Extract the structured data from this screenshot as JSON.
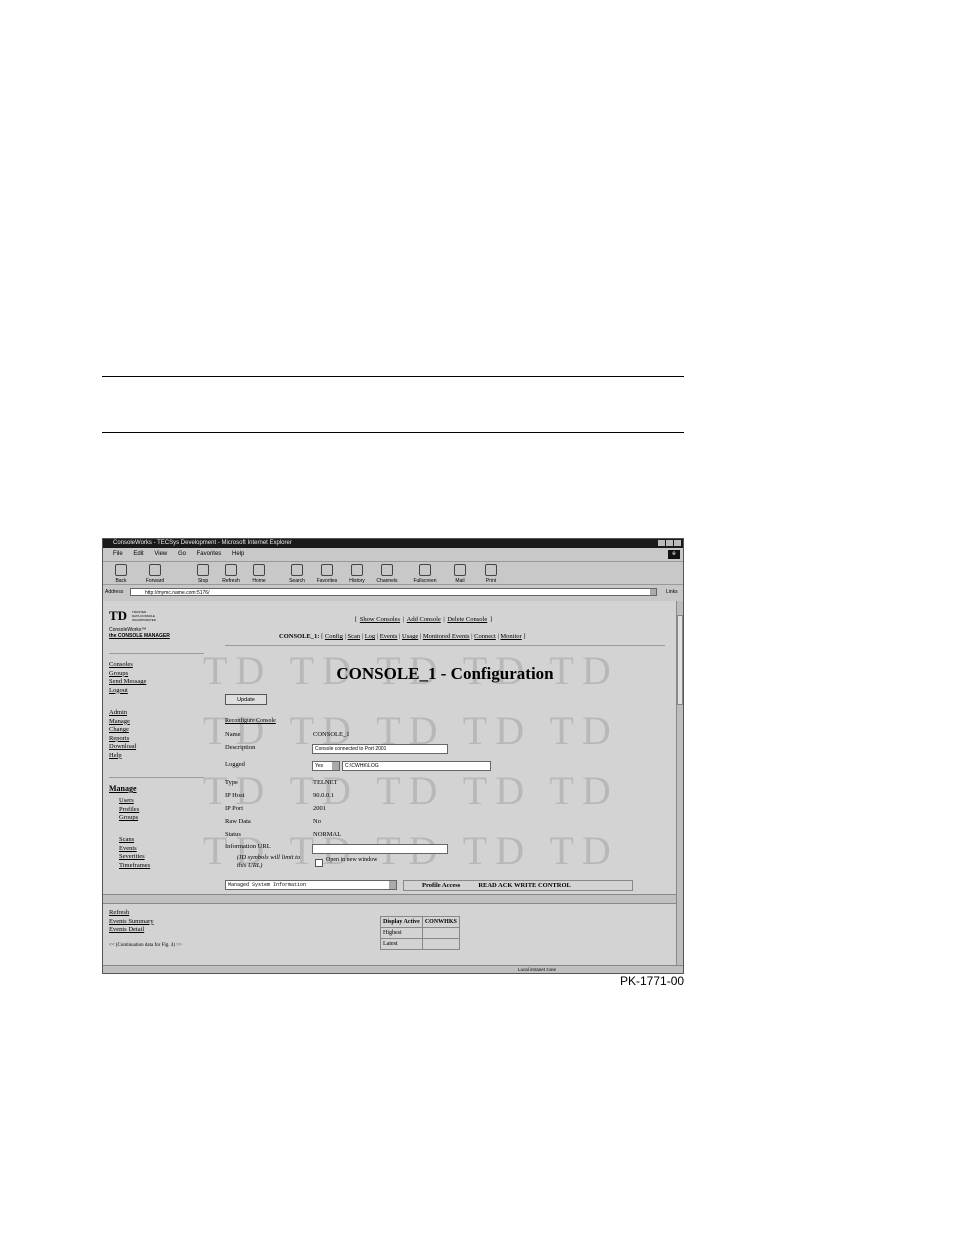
{
  "figure_code": "PK-1771-00",
  "window": {
    "title": "ConsoleWorks - TECSys Development - Microsoft Internet Explorer",
    "menu": [
      "File",
      "Edit",
      "View",
      "Go",
      "Favorites",
      "Help"
    ],
    "toolbar": [
      "Back",
      "Forward",
      "Stop",
      "Refresh",
      "Home",
      "Search",
      "Favorites",
      "History",
      "Channels",
      "Fullscreen",
      "Mail",
      "Print"
    ],
    "address_label": "Address",
    "address_value": "http://mymc.name.com:5176/",
    "links_label": "Links",
    "status_zone": "Local intranet zone"
  },
  "sidebar": {
    "logo": "TD",
    "logo_text": [
      "TRUSTED",
      "DATA CONSOLE",
      "INCORPORATED"
    ],
    "product": "ConsoleWorks™",
    "product_sub": "the CONSOLE MANAGER",
    "group1": [
      "Consoles",
      "Groups",
      "Send Message",
      "Logout"
    ],
    "group2": [
      "Admin",
      "Manage",
      "Change",
      "Reports",
      "Download",
      "Help"
    ],
    "manage_heading": "Manage",
    "manage_items": [
      "Users",
      "Profiles",
      "Groups"
    ],
    "manage_items2": [
      "Scans",
      "Events",
      "Severities",
      "Timeframes"
    ],
    "bottom": [
      "Refresh",
      "Events Summary",
      "Events Detail"
    ],
    "continuation": "<< (Continuation data for Fig. 4) >>"
  },
  "main": {
    "top_links": [
      "Show Consoles",
      "Add Console",
      "Delete Console"
    ],
    "console_name_prefix": "CONSOLE_1:",
    "console_links": [
      "Config",
      "Scan",
      "Log",
      "Events",
      "Usage",
      "Monitored Events",
      "Connect",
      "Monitor"
    ],
    "title": "CONSOLE_1 - Configuration",
    "update_button": "Update",
    "reconfigure_link": "Reconfigure Console",
    "fields": {
      "name_label": "Name",
      "name_value": "CONSOLE_1",
      "description_label": "Description",
      "description_value": "Console connected to Port 2001",
      "logged_label": "Logged",
      "logged_value": "Yes",
      "logged_path": "C:\\CWHK\\LOG",
      "type_label": "Type",
      "type_value": "TELNET",
      "iphost_label": "IP Host",
      "iphost_value": "90.0.0.1",
      "ipport_label": "IP Port",
      "ipport_value": "2001",
      "rawdata_label": "Raw Data",
      "rawdata_value": "No",
      "status_label": "Status",
      "status_value": "NORMAL",
      "infourl_label": "Information URL",
      "infourl_value": "",
      "infourl_note": "(ID symbols will limit to this URL)",
      "open_new_window": "Open in new window"
    },
    "managed_select": "Managed System Information",
    "profile_access_label": "Profile Access",
    "profile_access_value": "READ ACK WRITE CONTROL"
  },
  "display_table": {
    "header": [
      "Display Active",
      "CONWHKS"
    ],
    "rows": [
      "Highest",
      "Latest"
    ]
  }
}
